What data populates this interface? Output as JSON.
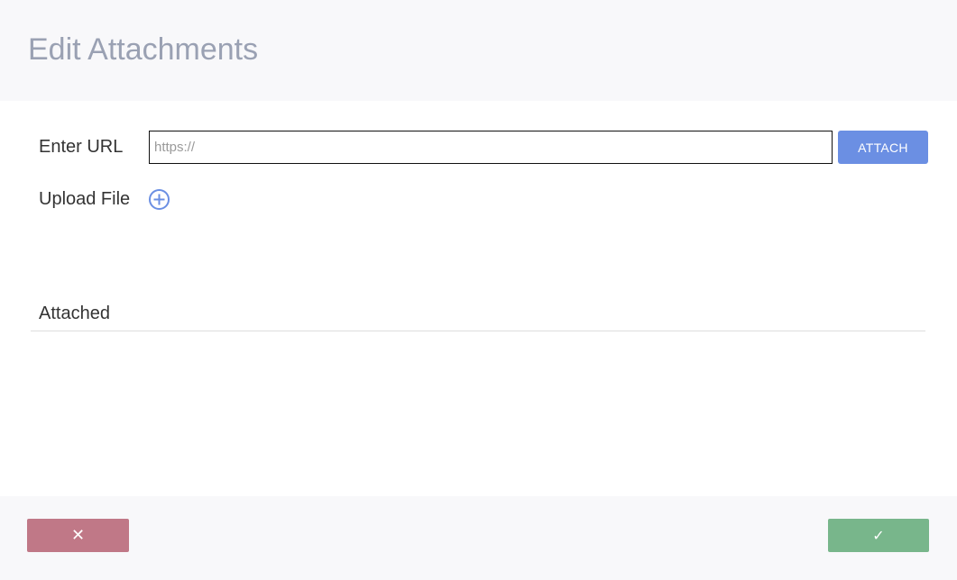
{
  "dialog": {
    "title": "Edit Attachments"
  },
  "url_row": {
    "label": "Enter URL",
    "input_value": "",
    "input_placeholder": "https://",
    "attach_label": "ATTACH"
  },
  "upload_row": {
    "label": "Upload File",
    "icon": "plus-circle-icon"
  },
  "attached_section": {
    "label": "Attached",
    "items": []
  },
  "footer": {
    "cancel_icon": "close-icon",
    "cancel_glyph": "✕",
    "confirm_icon": "check-icon",
    "confirm_glyph": "✓"
  },
  "colors": {
    "header_bg": "#f8f8fa",
    "title_text": "#9aa1b3",
    "attach_button": "#6b8fe3",
    "upload_icon": "#6b8fe3",
    "cancel_button": "#c07887",
    "confirm_button": "#78b68b"
  }
}
